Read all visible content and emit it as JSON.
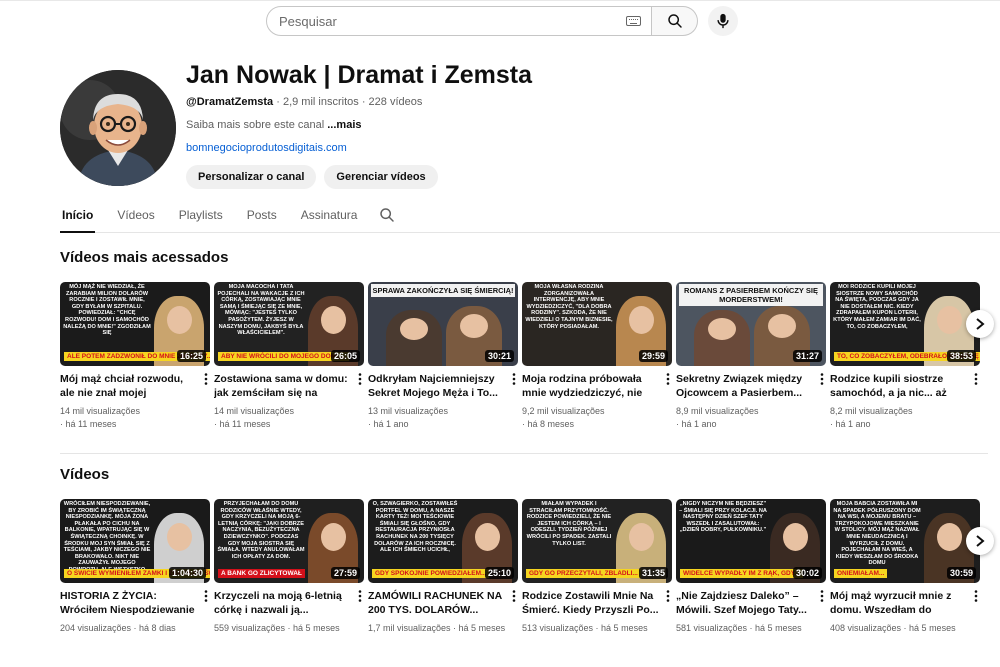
{
  "search": {
    "placeholder": "Pesquisar"
  },
  "channel": {
    "title": "Jan Nowak | Dramat i Zemsta",
    "handle": "@DramatZemsta",
    "subscribers": "2,9 mil inscritos",
    "videos_count": "228 vídeos",
    "about": "Saiba mais sobre este canal",
    "about_more": "...mais",
    "link": "bomnegocioprodutosdigitais.com",
    "customize_label": "Personalizar o canal",
    "manage_label": "Gerenciar vídeos"
  },
  "tabs": [
    {
      "label": "Início",
      "active": true
    },
    {
      "label": "Vídeos"
    },
    {
      "label": "Playlists"
    },
    {
      "label": "Posts"
    },
    {
      "label": "Assinatura"
    }
  ],
  "sections": {
    "popular_title": "Vídeos mais acessados",
    "videos_title": "Vídeos"
  },
  "popular": [
    {
      "title": "Mój mąż chciał rozwodu, ale nie znał mojej tajemnicy...",
      "views": "14 mil visualizações",
      "age": "há 11 meses",
      "duration": "16:25",
      "thumb_text": "MÓJ MĄŻ NIE WIEDZIAŁ, ŻE ZARABIAM MILION DOLARÓW ROCZNIE I ZOSTAWIŁ MNIE, GDY BYŁAM W SZPITALU. POWIEDZIAŁ: \"CHCĘ ROZWODU! DOM I SAMOCHÓD NALEŻĄ DO MNIE!\" ZGODZIŁAM SIĘ",
      "banner": "ALE POTEM ZADZWONIŁ DO MNIE 200 RAZY..."
    },
    {
      "title": "Zostawiona sama w domu: jak zemściłam się na mojej...",
      "views": "14 mil visualizações",
      "age": "há 11 meses",
      "duration": "26:05",
      "thumb_text": "MOJA MACOCHA I TATA POJECHALI NA WAKACJE Z ICH CÓRKĄ, ZOSTAWIAJĄC MNIE SAMĄ I ŚMIEJĄC SIĘ ZE MNIE, MÓWIĄC: \"JESTEŚ TYLKO PASOŻYTEM. ŻYJESZ W NASZYM DOMU, JAKBYŚ BYŁA WŁAŚCICIELEM\".",
      "banner": "ABY NIE WRÓCILI DO MOJEGO DOMU..."
    },
    {
      "title": "Odkryłam Najciemniejszy Sekret Mojego Męża i To...",
      "views": "13 mil visualizações",
      "age": "há 1 ano",
      "duration": "30:21",
      "thumb_text": "SPRAWA ZAKOŃCZYŁA SIĘ ŚMIERCIĄ!",
      "banner": ""
    },
    {
      "title": "Moja rodzina próbowała mnie wydziedziczyć, nie wiedząc...",
      "views": "9,2 mil visualizações",
      "age": "há 8 meses",
      "duration": "29:59",
      "thumb_text": "MOJA WŁASNA RODZINA ZORGANIZOWAŁA INTERWENCJĘ, ABY MNIE WYDZIEDZICZYĆ, \"DLA DOBRA RODZINY\". SZKODA, ŻE NIE WIEDZIELI O TAJNYM BIZNESIE, KTÓRY POSIADAŁAM.",
      "banner": ""
    },
    {
      "title": "Sekretny Związek między Ojcowcem a Pasierbem...",
      "views": "8,9 mil visualizações",
      "age": "há 1 ano",
      "duration": "31:27",
      "thumb_text": "ROMANS Z PASIERBEM KOŃCZY SIĘ MORDERSTWEM!",
      "banner": ""
    },
    {
      "title": "Rodzice kupili siostrze samochód, a ja nic... aż do...",
      "views": "8,2 mil visualizações",
      "age": "há 1 ano",
      "duration": "38:53",
      "thumb_text": "MOI RODZICE KUPILI MOJEJ SIOSTRZE NOWY SAMOCHÓD NA ŚWIĘTA, PODCZAS GDY JA NIE DOSTAŁEM NIC. KIEDY ZDRAPAŁEM KUPON LOTERII, KTÓRY MAŁEM ZAMIAR IM DAĆ, TO, CO ZOBACZYŁEM,",
      "banner": "TO, CO ZOBACZYŁEM, ODEBRAŁO MI MOWĘ"
    }
  ],
  "videos": [
    {
      "title": "HISTORIA Z ŻYCIA: Wróciłem Niespodziewanie Na Święta...",
      "views": "204 visualizações",
      "age": "há 8 dias",
      "duration": "1:04:30",
      "thumb_text": "WRÓCIŁEM NIESPODZIEWANIE, BY ZROBIĆ IM ŚWIĄTECZNĄ NIESPODZIANKĘ. MOJA ŻONA PŁAKAŁA PO CICHU NA BALKONIE, WPATRUJĄC SIĘ W ŚWIĄTECZNĄ CHOINKĘ. W ŚRODKU MOJ SYN ŚMIAŁ SIĘ Z TEŚCIAMI, JAKBY NICZEGO NIE BRAKOWAŁO. NIKT NIE ZAUWAŻYŁ MOJEGO POWROTU, ALE WSZYSTKO ZROZUMIAŁEM.",
      "banner": "O ŚWICIE WYMIENIŁEM ZAMKI I ZGASIŁEM ŚWIATŁA..."
    },
    {
      "title": "Krzyczeli na moją 6-letnią córkę i nazwali ją...",
      "views": "559 visualizações",
      "age": "há 5 meses",
      "duration": "27:59",
      "thumb_text": "PRZYJECHAŁAM DO DOMU RODZICÓW WŁAŚNIE WTEDY, GDY KRZYCZELI NA MOJĄ 6-LETNIĄ CÓRKĘ: \"JAKI DOBRZE NACZYNIA, BEZUŻYTECZNA DZIEWCZYNKO\". PODCZAS GDY MOJA SIOSTRA SIĘ ŚMIAŁA. WTEDY ANULOWAŁAM ICH OPŁATY ZA DOM.",
      "banner": "A BANK GO ZLICYTOWAŁ"
    },
    {
      "title": "ZAMÓWILI RACHUNEK NA 200 TYS. DOLARÓW... NIE...",
      "views": "1,7 mil visualizações",
      "age": "há 5 meses",
      "duration": "25:10",
      "thumb_text": "O, SZWAGIERKO, ZOSTAWIŁEŚ PORTFEL W DOMU, A NASZE KARTY TEŻ! MOI TEŚCIOWIE ŚMIALI SIĘ GŁOŚNO, GDY RESTAURACJA PRZYNIOSŁA RACHUNEK NA 200 TYSIĘCY DOLARÓW ZA ICH ROCZNICĘ. ALE ICH ŚMIECH UCICHŁ,",
      "banner": "GDY SPOKOJNIE POWIEDZIAŁEM..."
    },
    {
      "title": "Rodzice Zostawili Mnie Na Śmierć. Kiedy Przyszli Po...",
      "views": "513 visualizações",
      "age": "há 5 meses",
      "duration": "31:35",
      "thumb_text": "MIAŁAM WYPADEK I STRACIŁAM PRZYTOMNOŚĆ. RODZICE POWIEDZIELI, ŻE NIE JESTEM ICH CÓRKĄ – I ODESZLI. TYDZIEŃ PÓŹNIEJ WRÓCILI PO SPADEK. ZASTALI TYLKO LIST.",
      "banner": "GDY GO PRZECZYTALI, ZBLADLI..."
    },
    {
      "title": "„Nie Zajdziesz Daleko” – Mówili. Szef Mojego Taty...",
      "views": "581 visualizações",
      "age": "há 5 meses",
      "duration": "30:02",
      "thumb_text": "„NIGDY NICZYM NIE BĘDZIESZ” – ŚMIALI SIĘ PRZY KOLACJI. NA NASTĘPNY DZIEŃ SZEF TATY WSZEDŁ I ZASALUTOWAŁ: „DZIEŃ DOBRY, PUŁKOWNIKU.”",
      "banner": "WIDELCE WYPADŁY IM Z RĄK, GDY..."
    },
    {
      "title": "Mój mąż wyrzucił mnie z domu. Wszedłam do domu...",
      "views": "408 visualizações",
      "age": "há 5 meses",
      "duration": "30:59",
      "thumb_text": "MOJA BABCIA ZOSTAWIŁA MI NA SPADEK PÓŁRUSZONY DOM NA WSI, A MOJEMU BRATU – TRZYPOKOJOWE MIESZKANIE W STOLICY. MÓJ MĄŻ NAZWAŁ MNIE NIEUDACZNICĄ I WYRZUCIŁ Z DOMU. POJECHAŁAM NA WIEŚ, A KIEDY WESZŁAM DO ŚRODKA DOMU",
      "banner": "ONIEMIAŁAM..."
    }
  ],
  "colors": {
    "link": "#065fd4",
    "banner_red": "#d4101a",
    "banner_yellow": "#f6d520"
  }
}
